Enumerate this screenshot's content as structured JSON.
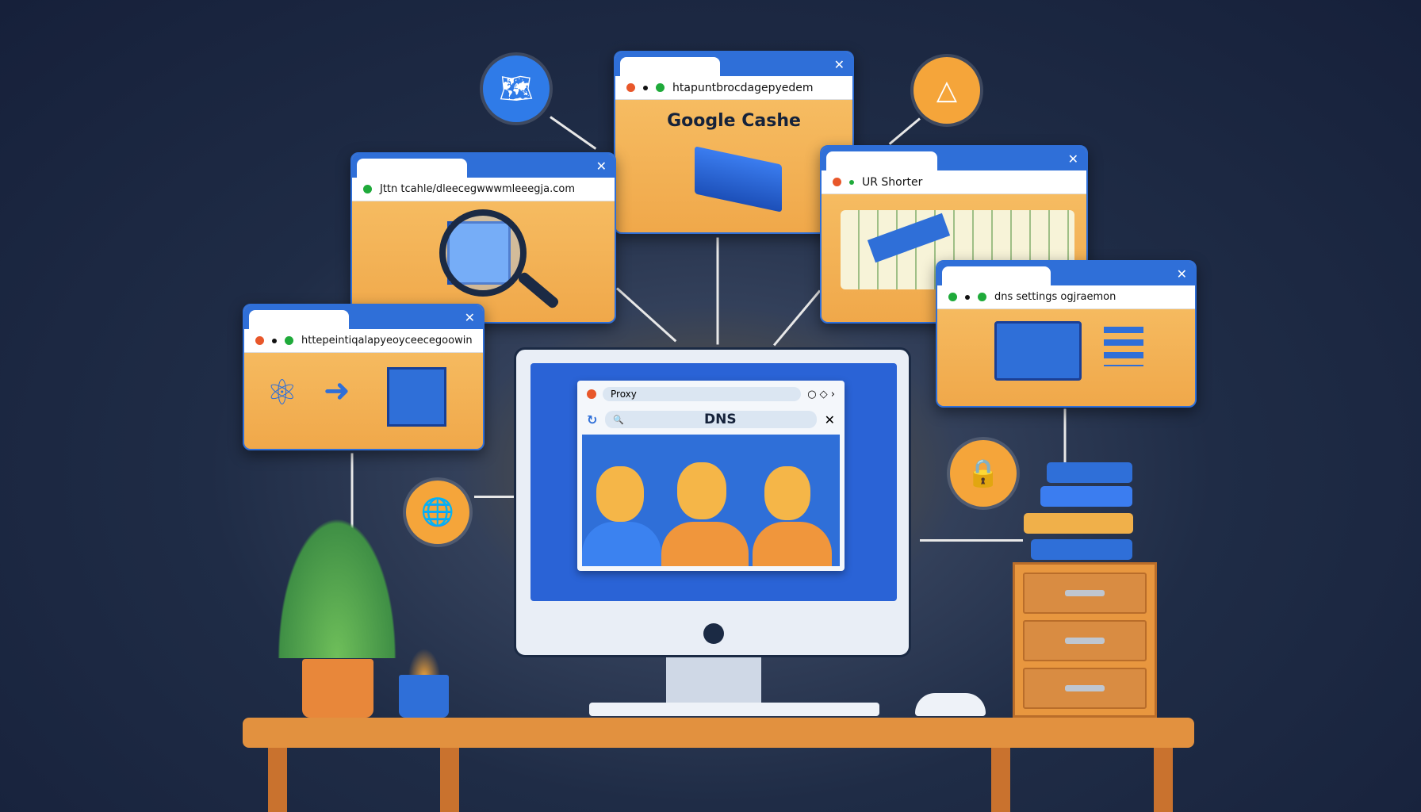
{
  "windows": {
    "google_cache": {
      "url": "htapuntbrocdagepyedem",
      "heading": "Google Cashe"
    },
    "search_window": {
      "url": "Jttn tcahle/dleecegwwwmleeegja.com"
    },
    "url_shortener": {
      "url": "UR Shorter"
    },
    "dns_settings": {
      "url": "dns settings ogjraemon"
    },
    "left_window": {
      "url": "httepeintiqalapyeoyceecegoowin"
    }
  },
  "monitor": {
    "browser": {
      "tab_label": "Proxy",
      "search_value": "DNS"
    }
  },
  "colors": {
    "accent_blue": "#2f6fd8",
    "window_orange": "#f5b558",
    "background": "#1f2c46"
  },
  "icons": [
    "map-icon",
    "warning-triangle-icon",
    "globe-icon",
    "lock-icon",
    "magnifier-icon",
    "cube-icon",
    "arrow-icon",
    "people-icon"
  ]
}
